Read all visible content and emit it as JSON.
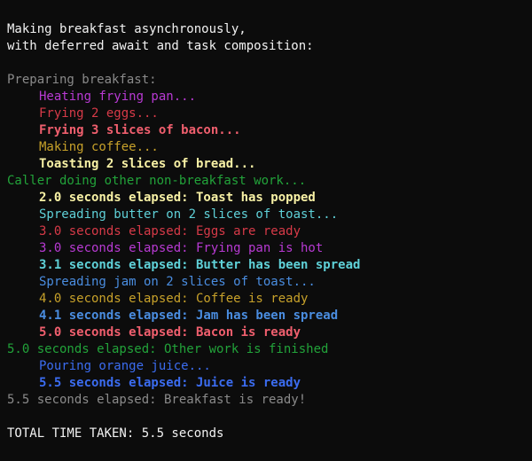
{
  "colors": {
    "background": "#0c0c0c",
    "white": "#f2f2f2",
    "gray": "#8a8a8a",
    "magenta": "#b83ad3",
    "red": "#d73a48",
    "bright_red": "#f05f6e",
    "yellow": "#c7a12a",
    "bright_yellow": "#f8f1a5",
    "green": "#22a33a",
    "cyan": "#5fd1d8",
    "blue": "#4a8de0",
    "bright_blue": "#3b6cf0"
  },
  "header": {
    "line1": "Making breakfast asynchronously,",
    "line2": "with deferred await and task composition:"
  },
  "log": [
    {
      "text": "Preparing breakfast:",
      "color": "#8a8a8a",
      "indent": false,
      "bold": false
    },
    {
      "text": "Heating frying pan...",
      "color": "#b83ad3",
      "indent": true,
      "bold": false
    },
    {
      "text": "Frying 2 eggs...",
      "color": "#d73a48",
      "indent": true,
      "bold": false
    },
    {
      "text": "Frying 3 slices of bacon...",
      "color": "#f05f6e",
      "indent": true,
      "bold": true
    },
    {
      "text": "Making coffee...",
      "color": "#c7a12a",
      "indent": true,
      "bold": false
    },
    {
      "text": "Toasting 2 slices of bread...",
      "color": "#f8f1a5",
      "indent": true,
      "bold": true
    },
    {
      "text": "Caller doing other non-breakfast work...",
      "color": "#22a33a",
      "indent": false,
      "bold": false
    },
    {
      "text": "2.0 seconds elapsed: Toast has popped",
      "color": "#f8f1a5",
      "indent": true,
      "bold": true
    },
    {
      "text": "Spreading butter on 2 slices of toast...",
      "color": "#5fd1d8",
      "indent": true,
      "bold": false
    },
    {
      "text": "3.0 seconds elapsed: Eggs are ready",
      "color": "#d73a48",
      "indent": true,
      "bold": false
    },
    {
      "text": "3.0 seconds elapsed: Frying pan is hot",
      "color": "#b83ad3",
      "indent": true,
      "bold": false
    },
    {
      "text": "3.1 seconds elapsed: Butter has been spread",
      "color": "#5fd1d8",
      "indent": true,
      "bold": true
    },
    {
      "text": "Spreading jam on 2 slices of toast...",
      "color": "#4a8de0",
      "indent": true,
      "bold": false
    },
    {
      "text": "4.0 seconds elapsed: Coffee is ready",
      "color": "#c7a12a",
      "indent": true,
      "bold": false
    },
    {
      "text": "4.1 seconds elapsed: Jam has been spread",
      "color": "#4a8de0",
      "indent": true,
      "bold": true
    },
    {
      "text": "5.0 seconds elapsed: Bacon is ready",
      "color": "#f05f6e",
      "indent": true,
      "bold": true
    },
    {
      "text": "5.0 seconds elapsed: Other work is finished",
      "color": "#22a33a",
      "indent": false,
      "bold": false
    },
    {
      "text": "Pouring orange juice...",
      "color": "#3b6cf0",
      "indent": true,
      "bold": false
    },
    {
      "text": "5.5 seconds elapsed: Juice is ready",
      "color": "#3b6cf0",
      "indent": true,
      "bold": true
    },
    {
      "text": "5.5 seconds elapsed: Breakfast is ready!",
      "color": "#8a8a8a",
      "indent": false,
      "bold": false
    }
  ],
  "footer": {
    "total": "TOTAL TIME TAKEN: 5.5 seconds"
  }
}
